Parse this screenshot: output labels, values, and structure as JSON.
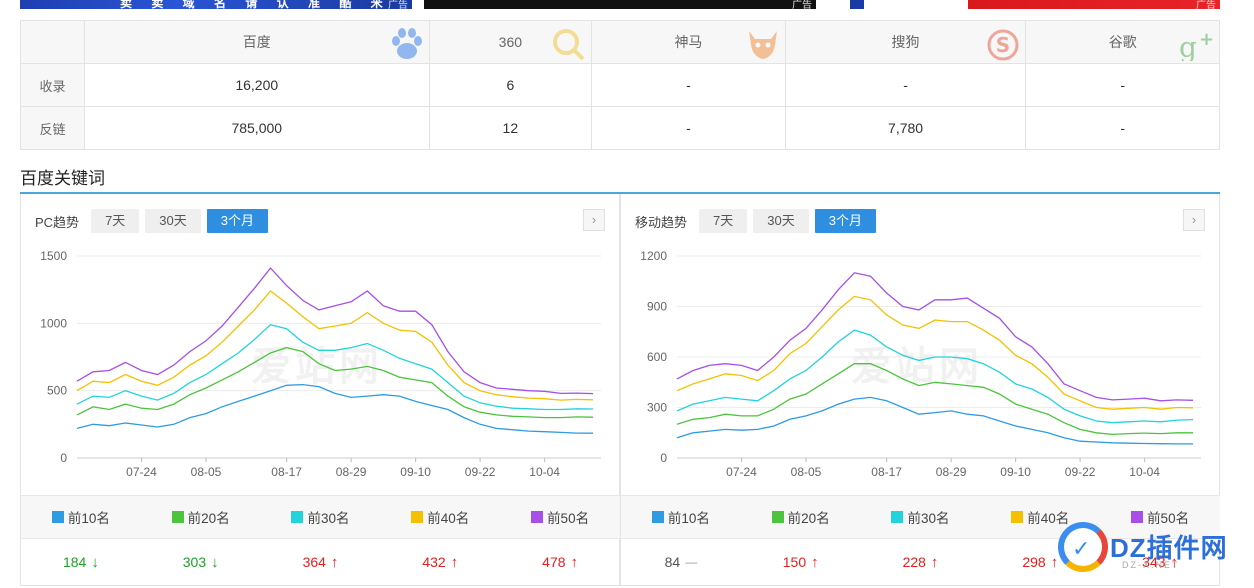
{
  "ads": {
    "tag": "广告",
    "ad1_text": "卖 卖 域 名 请 认 准 酷 米 网"
  },
  "engines": {
    "headers": [
      "百度",
      "360",
      "神马",
      "搜狗",
      "谷歌"
    ],
    "icons": [
      "baidu-paw-icon",
      "360-search-icon",
      "shenma-horse-icon",
      "sogou-s-icon",
      "google-plus-icon"
    ],
    "rows": [
      {
        "label": "收录",
        "values": [
          "16,200",
          "6",
          "-",
          "-",
          "-"
        ]
      },
      {
        "label": "反链",
        "values": [
          "785,000",
          "12",
          "-",
          "7,780",
          "-"
        ]
      }
    ]
  },
  "section_title": "百度关键词",
  "panels": [
    {
      "title": "PC趋势",
      "ranges": [
        "7天",
        "30天",
        "3个月"
      ],
      "active_range": "3个月",
      "legend": [
        "前10名",
        "前20名",
        "前30名",
        "前40名",
        "前50名"
      ],
      "values": [
        {
          "value": "184",
          "trend": "down"
        },
        {
          "value": "303",
          "trend": "down"
        },
        {
          "value": "364",
          "trend": "up"
        },
        {
          "value": "432",
          "trend": "up"
        },
        {
          "value": "478",
          "trend": "up"
        }
      ]
    },
    {
      "title": "移动趋势",
      "ranges": [
        "7天",
        "30天",
        "3个月"
      ],
      "active_range": "3个月",
      "legend": [
        "前10名",
        "前20名",
        "前30名",
        "前40名",
        "前50名"
      ],
      "values": [
        {
          "value": "84",
          "trend": "flat"
        },
        {
          "value": "150",
          "trend": "up"
        },
        {
          "value": "228",
          "trend": "up"
        },
        {
          "value": "298",
          "trend": "up"
        },
        {
          "value": "343",
          "trend": "up"
        }
      ]
    }
  ],
  "series_colors": [
    "#2f9be0",
    "#4cc43d",
    "#22d3dc",
    "#f5c000",
    "#a74fe6"
  ],
  "trend_colors": {
    "up": "#e02020",
    "down": "#1ea029",
    "flat": "#555555"
  },
  "chart_data": [
    {
      "type": "line",
      "ylim": [
        0,
        1500
      ],
      "yticks": [
        0,
        500,
        1000,
        1500
      ],
      "xticks": [
        "07-24",
        "08-05",
        "08-17",
        "08-29",
        "09-10",
        "09-22",
        "10-04"
      ],
      "series": [
        {
          "name": "前10名",
          "values": [
            220,
            250,
            240,
            260,
            245,
            230,
            250,
            300,
            330,
            380,
            420,
            460,
            500,
            540,
            545,
            530,
            480,
            450,
            460,
            470,
            460,
            420,
            390,
            360,
            300,
            250,
            220,
            210,
            200,
            195,
            190,
            185,
            184
          ]
        },
        {
          "name": "前20名",
          "values": [
            320,
            380,
            360,
            400,
            370,
            360,
            400,
            470,
            520,
            580,
            640,
            710,
            780,
            820,
            790,
            700,
            650,
            660,
            680,
            650,
            600,
            580,
            560,
            460,
            380,
            340,
            320,
            310,
            305,
            300,
            300,
            305,
            303
          ]
        },
        {
          "name": "前30名",
          "values": [
            400,
            460,
            450,
            500,
            460,
            430,
            480,
            560,
            620,
            700,
            780,
            880,
            990,
            960,
            860,
            800,
            800,
            820,
            850,
            800,
            740,
            700,
            660,
            560,
            460,
            410,
            385,
            370,
            365,
            360,
            360,
            365,
            364
          ]
        },
        {
          "name": "前40名",
          "values": [
            500,
            570,
            560,
            620,
            570,
            540,
            600,
            690,
            760,
            860,
            980,
            1100,
            1240,
            1150,
            1050,
            960,
            980,
            1000,
            1080,
            1000,
            950,
            940,
            860,
            690,
            560,
            500,
            470,
            455,
            445,
            440,
            430,
            435,
            432
          ]
        },
        {
          "name": "前50名",
          "values": [
            570,
            640,
            650,
            710,
            650,
            620,
            690,
            790,
            870,
            980,
            1120,
            1260,
            1410,
            1280,
            1170,
            1100,
            1130,
            1160,
            1240,
            1130,
            1090,
            1090,
            990,
            790,
            640,
            560,
            520,
            510,
            500,
            495,
            480,
            482,
            478
          ]
        }
      ]
    },
    {
      "type": "line",
      "ylim": [
        0,
        1200
      ],
      "yticks": [
        0,
        300,
        600,
        900,
        1200
      ],
      "xticks": [
        "07-24",
        "08-05",
        "08-17",
        "08-29",
        "09-10",
        "09-22",
        "10-04"
      ],
      "series": [
        {
          "name": "前10名",
          "values": [
            120,
            150,
            160,
            170,
            165,
            170,
            190,
            230,
            250,
            280,
            320,
            350,
            360,
            340,
            300,
            260,
            270,
            280,
            260,
            250,
            220,
            190,
            170,
            150,
            120,
            100,
            95,
            90,
            88,
            86,
            85,
            84,
            84
          ]
        },
        {
          "name": "前20名",
          "values": [
            200,
            230,
            240,
            260,
            250,
            250,
            290,
            350,
            380,
            440,
            500,
            560,
            560,
            520,
            470,
            430,
            450,
            440,
            430,
            420,
            380,
            320,
            290,
            260,
            210,
            170,
            150,
            140,
            145,
            148,
            145,
            150,
            150
          ]
        },
        {
          "name": "前30名",
          "values": [
            280,
            320,
            340,
            360,
            350,
            340,
            400,
            470,
            520,
            600,
            690,
            760,
            730,
            660,
            610,
            580,
            600,
            600,
            590,
            560,
            510,
            440,
            410,
            360,
            290,
            250,
            220,
            210,
            215,
            220,
            215,
            225,
            228
          ]
        },
        {
          "name": "前40名",
          "values": [
            400,
            440,
            470,
            500,
            490,
            460,
            520,
            620,
            680,
            780,
            880,
            960,
            940,
            850,
            790,
            770,
            820,
            810,
            810,
            760,
            700,
            610,
            560,
            480,
            380,
            340,
            300,
            290,
            295,
            300,
            290,
            300,
            298
          ]
        },
        {
          "name": "前50名",
          "values": [
            470,
            520,
            550,
            560,
            550,
            520,
            600,
            700,
            770,
            880,
            1000,
            1100,
            1080,
            980,
            900,
            880,
            940,
            940,
            950,
            890,
            830,
            720,
            660,
            560,
            440,
            400,
            360,
            345,
            350,
            355,
            340,
            345,
            343
          ]
        }
      ]
    }
  ],
  "dz_watermark": {
    "text": "DZ插件网",
    "sub": "DZ-X.NET"
  }
}
